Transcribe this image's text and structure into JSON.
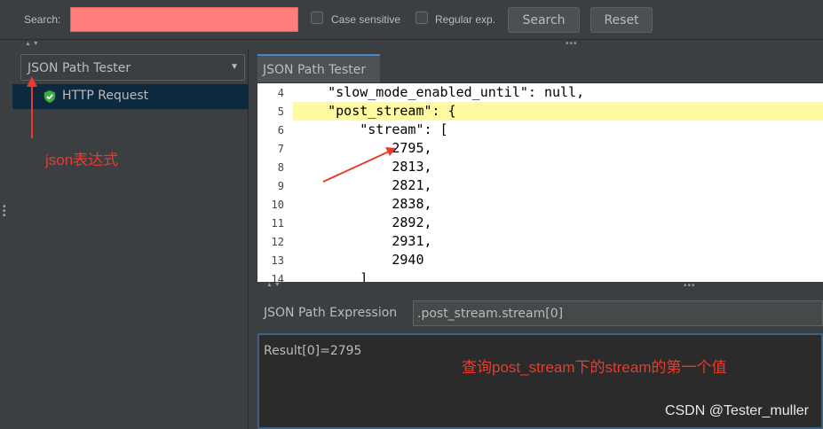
{
  "search": {
    "label": "Search:",
    "value": "",
    "case_sensitive_label": "Case sensitive",
    "regular_exp_label": "Regular exp.",
    "search_button": "Search",
    "reset_button": "Reset"
  },
  "left": {
    "combo_value": "JSON Path Tester",
    "tree_item": "HTTP Request"
  },
  "tab": {
    "label": "JSON Path Tester"
  },
  "editor": {
    "lines": [
      {
        "num": "4",
        "text": "    \"slow_mode_enabled_until\": null,"
      },
      {
        "num": "5",
        "text": "    \"post_stream\": {",
        "highlighted": true
      },
      {
        "num": "6",
        "text": "        \"stream\": ["
      },
      {
        "num": "7",
        "text": "            2795,"
      },
      {
        "num": "8",
        "text": "            2813,"
      },
      {
        "num": "9",
        "text": "            2821,"
      },
      {
        "num": "10",
        "text": "            2838,"
      },
      {
        "num": "11",
        "text": "            2892,"
      },
      {
        "num": "12",
        "text": "            2931,"
      },
      {
        "num": "13",
        "text": "            2940"
      },
      {
        "num": "14",
        "text": "        ]"
      }
    ]
  },
  "expression": {
    "label": "JSON Path Expression",
    "value": ".post_stream.stream[0]"
  },
  "result": {
    "text": "Result[0]=2795"
  },
  "annotations": {
    "json_expr": "json表达式",
    "query_note": "查询post_stream下的stream的第一个值"
  },
  "watermark": "CSDN @Tester_muller",
  "colors": {
    "search_highlight": "#ff7f7f",
    "annotation_red": "#e83b2e",
    "line_highlight": "#fefaa0",
    "tab_accent": "#4a88c7"
  }
}
